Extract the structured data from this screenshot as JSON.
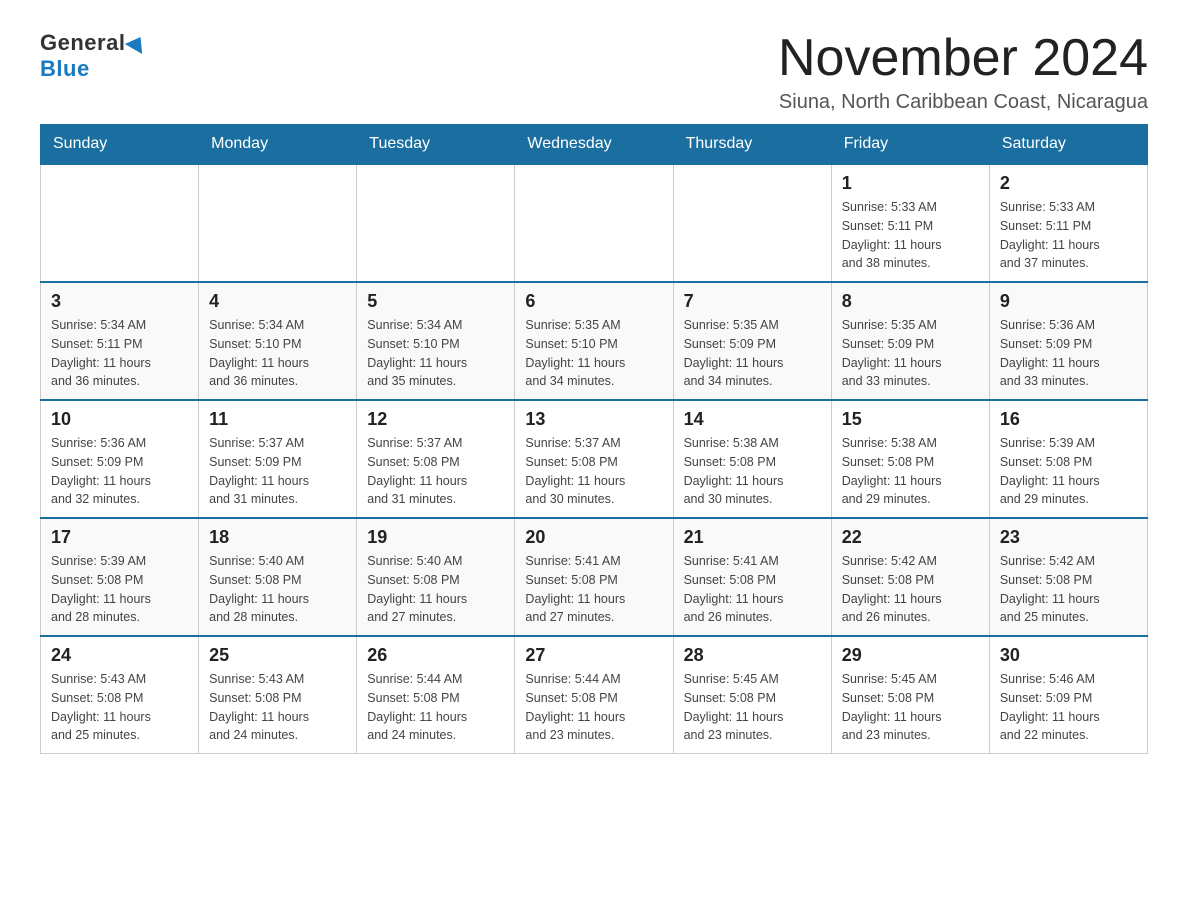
{
  "header": {
    "logo_general": "General",
    "logo_blue": "Blue",
    "month_year": "November 2024",
    "location": "Siuna, North Caribbean Coast, Nicaragua"
  },
  "weekdays": [
    "Sunday",
    "Monday",
    "Tuesday",
    "Wednesday",
    "Thursday",
    "Friday",
    "Saturday"
  ],
  "weeks": [
    {
      "days": [
        {
          "number": "",
          "info": ""
        },
        {
          "number": "",
          "info": ""
        },
        {
          "number": "",
          "info": ""
        },
        {
          "number": "",
          "info": ""
        },
        {
          "number": "",
          "info": ""
        },
        {
          "number": "1",
          "info": "Sunrise: 5:33 AM\nSunset: 5:11 PM\nDaylight: 11 hours\nand 38 minutes."
        },
        {
          "number": "2",
          "info": "Sunrise: 5:33 AM\nSunset: 5:11 PM\nDaylight: 11 hours\nand 37 minutes."
        }
      ]
    },
    {
      "days": [
        {
          "number": "3",
          "info": "Sunrise: 5:34 AM\nSunset: 5:11 PM\nDaylight: 11 hours\nand 36 minutes."
        },
        {
          "number": "4",
          "info": "Sunrise: 5:34 AM\nSunset: 5:10 PM\nDaylight: 11 hours\nand 36 minutes."
        },
        {
          "number": "5",
          "info": "Sunrise: 5:34 AM\nSunset: 5:10 PM\nDaylight: 11 hours\nand 35 minutes."
        },
        {
          "number": "6",
          "info": "Sunrise: 5:35 AM\nSunset: 5:10 PM\nDaylight: 11 hours\nand 34 minutes."
        },
        {
          "number": "7",
          "info": "Sunrise: 5:35 AM\nSunset: 5:09 PM\nDaylight: 11 hours\nand 34 minutes."
        },
        {
          "number": "8",
          "info": "Sunrise: 5:35 AM\nSunset: 5:09 PM\nDaylight: 11 hours\nand 33 minutes."
        },
        {
          "number": "9",
          "info": "Sunrise: 5:36 AM\nSunset: 5:09 PM\nDaylight: 11 hours\nand 33 minutes."
        }
      ]
    },
    {
      "days": [
        {
          "number": "10",
          "info": "Sunrise: 5:36 AM\nSunset: 5:09 PM\nDaylight: 11 hours\nand 32 minutes."
        },
        {
          "number": "11",
          "info": "Sunrise: 5:37 AM\nSunset: 5:09 PM\nDaylight: 11 hours\nand 31 minutes."
        },
        {
          "number": "12",
          "info": "Sunrise: 5:37 AM\nSunset: 5:08 PM\nDaylight: 11 hours\nand 31 minutes."
        },
        {
          "number": "13",
          "info": "Sunrise: 5:37 AM\nSunset: 5:08 PM\nDaylight: 11 hours\nand 30 minutes."
        },
        {
          "number": "14",
          "info": "Sunrise: 5:38 AM\nSunset: 5:08 PM\nDaylight: 11 hours\nand 30 minutes."
        },
        {
          "number": "15",
          "info": "Sunrise: 5:38 AM\nSunset: 5:08 PM\nDaylight: 11 hours\nand 29 minutes."
        },
        {
          "number": "16",
          "info": "Sunrise: 5:39 AM\nSunset: 5:08 PM\nDaylight: 11 hours\nand 29 minutes."
        }
      ]
    },
    {
      "days": [
        {
          "number": "17",
          "info": "Sunrise: 5:39 AM\nSunset: 5:08 PM\nDaylight: 11 hours\nand 28 minutes."
        },
        {
          "number": "18",
          "info": "Sunrise: 5:40 AM\nSunset: 5:08 PM\nDaylight: 11 hours\nand 28 minutes."
        },
        {
          "number": "19",
          "info": "Sunrise: 5:40 AM\nSunset: 5:08 PM\nDaylight: 11 hours\nand 27 minutes."
        },
        {
          "number": "20",
          "info": "Sunrise: 5:41 AM\nSunset: 5:08 PM\nDaylight: 11 hours\nand 27 minutes."
        },
        {
          "number": "21",
          "info": "Sunrise: 5:41 AM\nSunset: 5:08 PM\nDaylight: 11 hours\nand 26 minutes."
        },
        {
          "number": "22",
          "info": "Sunrise: 5:42 AM\nSunset: 5:08 PM\nDaylight: 11 hours\nand 26 minutes."
        },
        {
          "number": "23",
          "info": "Sunrise: 5:42 AM\nSunset: 5:08 PM\nDaylight: 11 hours\nand 25 minutes."
        }
      ]
    },
    {
      "days": [
        {
          "number": "24",
          "info": "Sunrise: 5:43 AM\nSunset: 5:08 PM\nDaylight: 11 hours\nand 25 minutes."
        },
        {
          "number": "25",
          "info": "Sunrise: 5:43 AM\nSunset: 5:08 PM\nDaylight: 11 hours\nand 24 minutes."
        },
        {
          "number": "26",
          "info": "Sunrise: 5:44 AM\nSunset: 5:08 PM\nDaylight: 11 hours\nand 24 minutes."
        },
        {
          "number": "27",
          "info": "Sunrise: 5:44 AM\nSunset: 5:08 PM\nDaylight: 11 hours\nand 23 minutes."
        },
        {
          "number": "28",
          "info": "Sunrise: 5:45 AM\nSunset: 5:08 PM\nDaylight: 11 hours\nand 23 minutes."
        },
        {
          "number": "29",
          "info": "Sunrise: 5:45 AM\nSunset: 5:08 PM\nDaylight: 11 hours\nand 23 minutes."
        },
        {
          "number": "30",
          "info": "Sunrise: 5:46 AM\nSunset: 5:09 PM\nDaylight: 11 hours\nand 22 minutes."
        }
      ]
    }
  ]
}
